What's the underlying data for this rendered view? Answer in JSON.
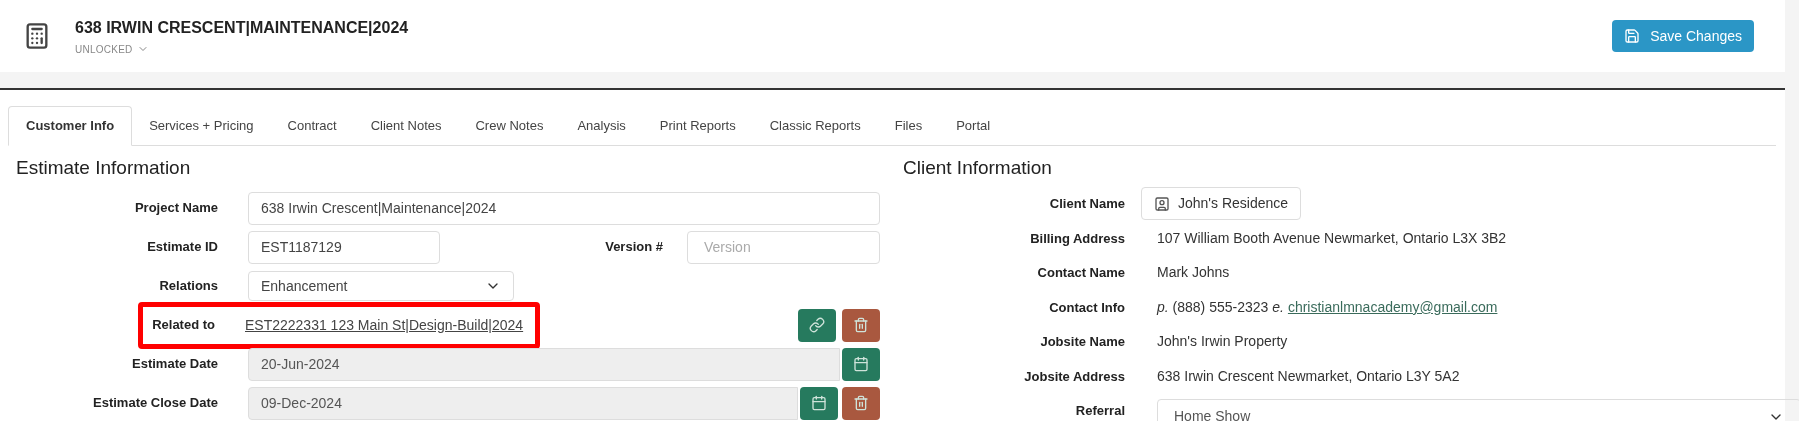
{
  "header": {
    "title": "638 IRWIN CRESCENT|MAINTENANCE|2024",
    "status": "UNLOCKED",
    "save_button": "Save Changes"
  },
  "tabs": [
    {
      "label": "Customer Info",
      "selected": true
    },
    {
      "label": "Services + Pricing",
      "selected": false
    },
    {
      "label": "Contract",
      "selected": false
    },
    {
      "label": "Client Notes",
      "selected": false
    },
    {
      "label": "Crew Notes",
      "selected": false
    },
    {
      "label": "Analysis",
      "selected": false
    },
    {
      "label": "Print Reports",
      "selected": false
    },
    {
      "label": "Classic Reports",
      "selected": false
    },
    {
      "label": "Files",
      "selected": false
    },
    {
      "label": "Portal",
      "selected": false
    }
  ],
  "estimate": {
    "heading": "Estimate Information",
    "fields": [
      {
        "kind": "input",
        "label": "Project Name",
        "value": "638 Irwin Crescent|Maintenance|2024"
      },
      {
        "kind": "pair",
        "label": "Estimate ID",
        "value": "EST1187129",
        "label_2": "Version #",
        "placeholder": "Version"
      },
      {
        "kind": "select",
        "label": "Relations",
        "value": "Enhancement"
      },
      {
        "kind": "link",
        "label": "Related to",
        "value": "EST2222331 123 Main St|Design-Build|2024",
        "highlighted": true
      },
      {
        "kind": "date",
        "label": "Estimate Date",
        "value": "20-Jun-2024",
        "removable": false
      },
      {
        "kind": "date",
        "label": "Estimate Close Date",
        "value": "09-Dec-2024",
        "removable": true
      }
    ]
  },
  "client": {
    "heading": "Client Information",
    "rows": [
      {
        "kind": "client",
        "label": "Client Name",
        "value": "John's Residence"
      },
      {
        "kind": "text",
        "label": "Billing Address",
        "value": "107 William Booth Avenue Newmarket, Ontario L3X 3B2"
      },
      {
        "kind": "text",
        "label": "Contact Name",
        "value": "Mark Johns"
      },
      {
        "kind": "contact",
        "label": "Contact Info",
        "phone": "*p.* (888) 555-2323 *e.*",
        "email": "christianlmnacademy@gmail.com"
      },
      {
        "kind": "text",
        "label": "Jobsite Name",
        "value": "John's Irwin Property"
      },
      {
        "kind": "text",
        "label": "Jobsite Address",
        "value": "638 Irwin Crescent Newmarket, Ontario L3Y 5A2"
      },
      {
        "kind": "select",
        "label": "Referral",
        "value": "Home Show"
      }
    ]
  }
}
